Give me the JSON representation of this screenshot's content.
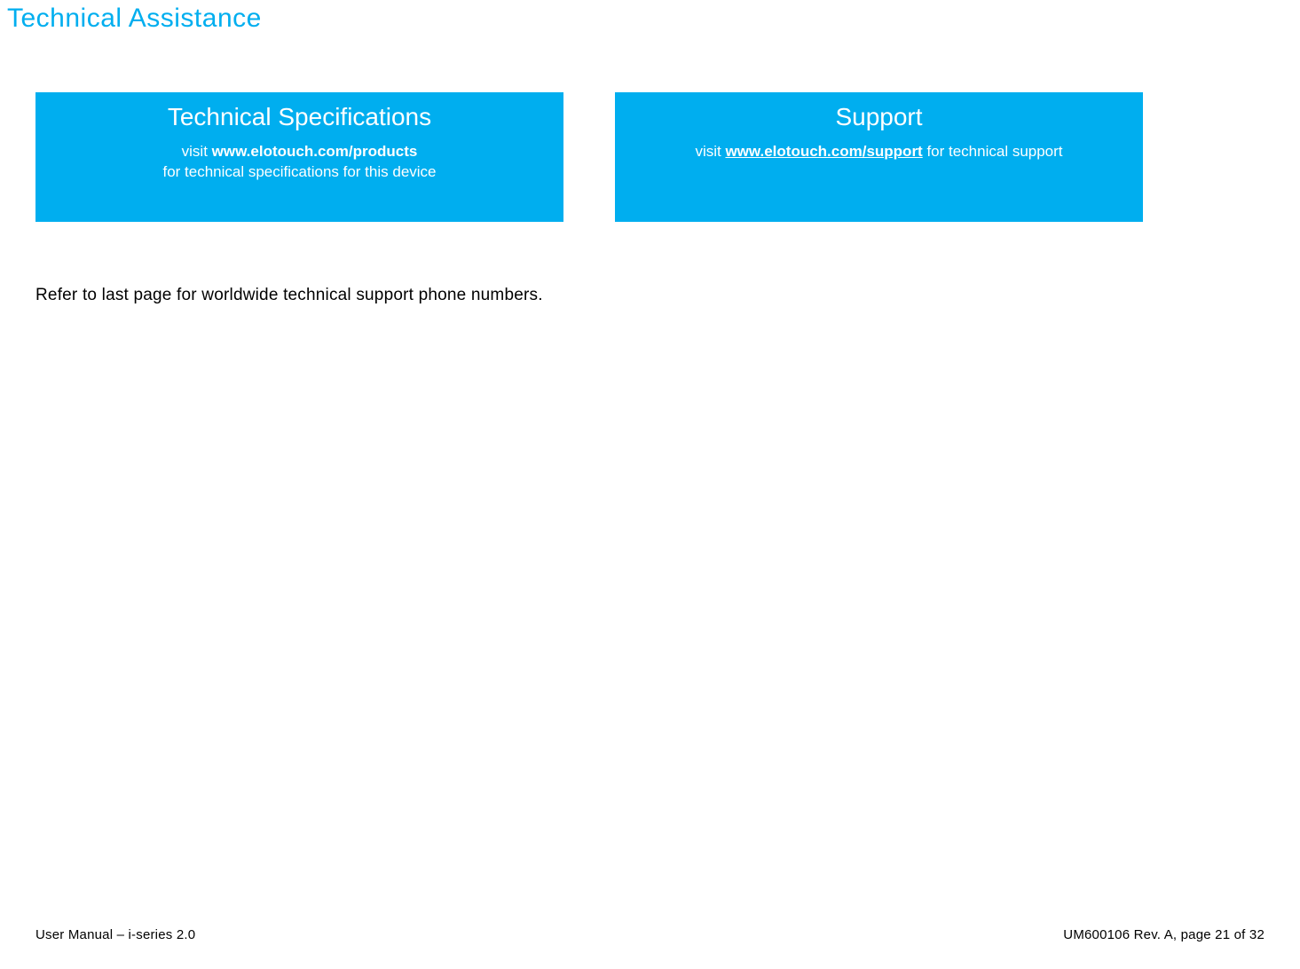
{
  "page": {
    "title": "Technical Assistance"
  },
  "cards": {
    "tech_specs": {
      "title": "Technical Specifications",
      "visit": "visit ",
      "url": "www.elotouch.com/products",
      "line2": "for technical specifications for this device"
    },
    "support": {
      "title": "Support",
      "visit": "visit ",
      "url": "www.elotouch.com/support",
      "suffix": " for technical support"
    }
  },
  "note": "Refer to last page for worldwide technical support phone numbers.",
  "footer": {
    "left": "User Manual – i-series 2.0",
    "right": "UM600106 Rev. A, page 21 of 32"
  }
}
